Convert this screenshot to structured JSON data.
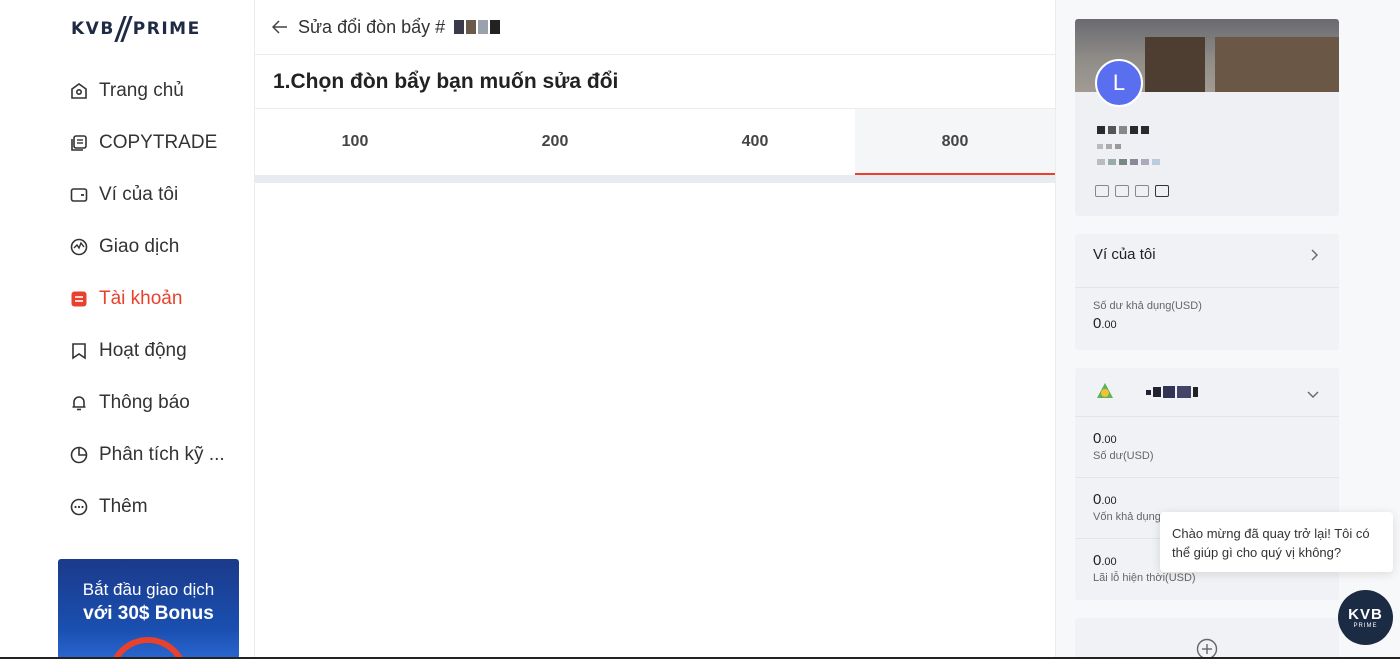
{
  "logo": {
    "left": "KVB",
    "right": "PRIME"
  },
  "sidebar": {
    "items": [
      {
        "label": "Trang chủ",
        "icon": "home-icon"
      },
      {
        "label": "COPYTRADE",
        "icon": "copy-icon"
      },
      {
        "label": "Ví của tôi",
        "icon": "wallet-icon"
      },
      {
        "label": "Giao dịch",
        "icon": "trade-icon"
      },
      {
        "label": "Tài khoản",
        "icon": "account-icon",
        "active": true
      },
      {
        "label": "Hoạt động",
        "icon": "bookmark-icon"
      },
      {
        "label": "Thông báo",
        "icon": "bell-icon"
      },
      {
        "label": "Phân tích kỹ ...",
        "icon": "pie-chart-icon"
      },
      {
        "label": "Thêm",
        "icon": "more-icon"
      }
    ],
    "promo": {
      "line1": "Bắt đầu giao dịch",
      "line2": "với 30$ Bonus"
    }
  },
  "header": {
    "title": "Sửa đổi đòn bẩy #"
  },
  "section": {
    "title": "1.Chọn đòn bẩy bạn muốn sửa đổi"
  },
  "leverage": {
    "options": [
      "100",
      "200",
      "400",
      "800"
    ],
    "selected": "800"
  },
  "profile": {
    "avatar_letter": "L"
  },
  "wallet": {
    "title": "Ví của tôi",
    "available_label": "Số dư khả dụng(USD)",
    "available_int": "0",
    "available_dec": ".00"
  },
  "account": {
    "balance_int": "0",
    "balance_dec": ".00",
    "balance_label": "Số dư(USD)",
    "margin_int": "0",
    "margin_dec": ".00",
    "margin_label": "Vốn khả dụng",
    "pnl_int": "0",
    "pnl_dec": ".00",
    "pnl_label": "Lãi lỗ hiện thời(USD)"
  },
  "chat": {
    "message": "Chào mừng đã quay trở lại! Tôi có thể giúp gì cho quý vị không?"
  },
  "fab": {
    "line1": "KVB",
    "line2": "PRIME"
  },
  "colors": {
    "accent": "#e8412e",
    "navy": "#1c2b44",
    "avatar": "#5a6ff0"
  }
}
